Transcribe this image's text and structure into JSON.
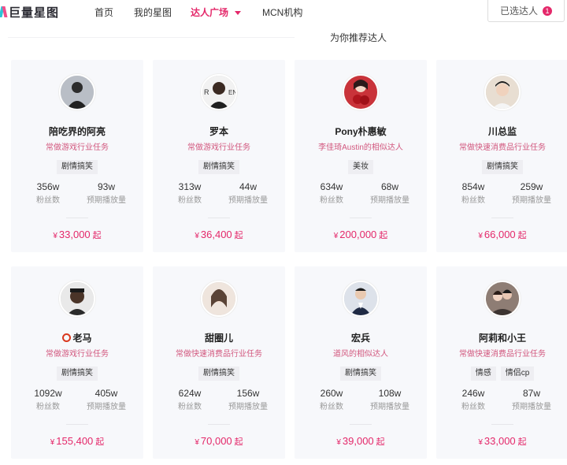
{
  "header": {
    "logo_text": "巨量星图",
    "nav": [
      {
        "label": "首页"
      },
      {
        "label": "我的星图"
      },
      {
        "label": "达人广场"
      },
      {
        "label": "MCN机构"
      }
    ],
    "selected_label": "已选达人",
    "selected_count": "1"
  },
  "section_title": "为你推荐达人",
  "currency": "¥",
  "price_suffix": "起",
  "fans_label": "粉丝数",
  "plays_label": "预期播放量",
  "cards": [
    {
      "name": "陪吃界的阿亮",
      "desc": "常做游戏行业任务",
      "tags": [
        "剧情搞笑"
      ],
      "fans": "356w",
      "plays": "93w",
      "price": "33,000",
      "avatar_color": "#9aa0a8"
    },
    {
      "name": "罗本",
      "desc": "常做游戏行业任务",
      "tags": [
        "剧情搞笑"
      ],
      "fans": "313w",
      "plays": "44w",
      "price": "36,400",
      "avatar_color": "#6f6a63"
    },
    {
      "name": "Pony朴惠敏",
      "desc": "李佳琦Austin的相似达人",
      "tags": [
        "美妆"
      ],
      "fans": "634w",
      "plays": "68w",
      "price": "200,000",
      "avatar_color": "#c4373d"
    },
    {
      "name": "川总监",
      "desc": "常做快速消费品行业任务",
      "tags": [
        "剧情搞笑"
      ],
      "fans": "854w",
      "plays": "259w",
      "price": "66,000",
      "avatar_color": "#d9c9b8"
    },
    {
      "name": "老马",
      "desc": "常做游戏行业任务",
      "tags": [
        "剧情搞笑"
      ],
      "fans": "1092w",
      "plays": "405w",
      "price": "155,400",
      "avatar_color": "#5b4638"
    },
    {
      "name": "甜圈儿",
      "desc": "常做快速消费品行业任务",
      "tags": [
        "剧情搞笑"
      ],
      "fans": "624w",
      "plays": "156w",
      "price": "70,000",
      "avatar_color": "#e6d6cb"
    },
    {
      "name": "宏兵",
      "desc": "道风的相似达人",
      "tags": [
        "剧情搞笑"
      ],
      "fans": "260w",
      "plays": "108w",
      "price": "39,000",
      "avatar_color": "#45506a"
    },
    {
      "name": "阿莉和小王",
      "desc": "常做快速消费品行业任务",
      "tags": [
        "情感",
        "情侣cp"
      ],
      "fans": "246w",
      "plays": "87w",
      "price": "33,000",
      "avatar_color": "#8e7d74"
    }
  ]
}
